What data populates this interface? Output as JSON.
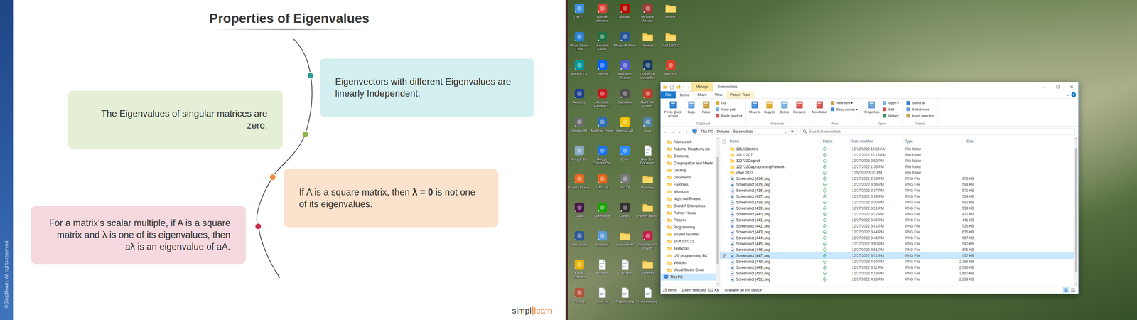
{
  "slide": {
    "watermark": "©Simplilearn. All rights reserved.",
    "title": "Properties of Eigenvalues",
    "properties": [
      {
        "segments": [
          {
            "text": "Eigenvectors with different Eigenvalues are linearly Independent.",
            "bold": false
          }
        ],
        "color": "#d3eff0",
        "dot_color": "#2f9c94"
      },
      {
        "segments": [
          {
            "text": "The Eigenvalues of singular matrices are zero.",
            "bold": false
          }
        ],
        "color": "#e4efd6",
        "dot_color": "#8fb448"
      },
      {
        "segments": [
          {
            "text": "If A is a square matrix, then ",
            "bold": false
          },
          {
            "text": "λ = 0",
            "bold": true
          },
          {
            "text": " is not one of its eigenvalues.",
            "bold": false
          }
        ],
        "color": "#fbe2cd",
        "dot_color": "#f08c3a"
      },
      {
        "segments": [
          {
            "text": "For a matrix's scalar multiple, if A is a square matrix and λ is one of its eigenvalues, then aλ is an eigenvalue of aA.",
            "bold": false
          }
        ],
        "color": "#f5d9df",
        "dot_color": "#c9304c"
      }
    ],
    "logo": {
      "left": "simpl",
      "right": "learn"
    }
  },
  "desktop": {
    "icons": [
      {
        "label": "This PC",
        "kind": "app",
        "color": "#3d8fe0"
      },
      {
        "label": "Visual Studio Code",
        "kind": "app",
        "color": "#2a7fd4"
      },
      {
        "label": "Arduino IDE",
        "kind": "app",
        "color": "#00979d"
      },
      {
        "label": "Audacity",
        "kind": "app",
        "color": "#1d3f8c"
      },
      {
        "label": "Simplify3D",
        "kind": "app",
        "color": "#6b6b6b"
      },
      {
        "label": "Recycle Bin",
        "kind": "app",
        "color": "#8aa6c1"
      },
      {
        "label": "Mozilla Firefox",
        "kind": "app",
        "color": "#e66a21"
      },
      {
        "label": "Slack",
        "kind": "app",
        "color": "#4a154b"
      },
      {
        "label": "Video Editor",
        "kind": "app",
        "color": "#2b5797"
      },
      {
        "label": "Kodak Software",
        "kind": "app",
        "color": "#e9b308"
      },
      {
        "label": "Fritzing",
        "kind": "app",
        "color": "#b5523b"
      },
      {
        "label": "Google Chrome",
        "kind": "app",
        "color": "#db4437"
      },
      {
        "label": "Microsoft Excel",
        "kind": "app",
        "color": "#1e7145"
      },
      {
        "label": "Dropbox",
        "kind": "app",
        "color": "#0061fe"
      },
      {
        "label": "Acrobat Reader DC",
        "kind": "app",
        "color": "#c4161c"
      },
      {
        "label": "Mathcad Prime",
        "kind": "app",
        "color": "#2c6fb5"
      },
      {
        "label": "Google Chrome Dev",
        "kind": "app",
        "color": "#1a73e8"
      },
      {
        "label": "MATLAB",
        "kind": "app",
        "color": "#e1641b"
      },
      {
        "label": "LibreOffice",
        "kind": "app",
        "color": "#18a303"
      },
      {
        "label": "Notepad",
        "kind": "app",
        "color": "#5b9bd5"
      },
      {
        "label": "budget.txt",
        "kind": "file",
        "color": "#ffffff"
      },
      {
        "label": "notes.txt",
        "kind": "file",
        "color": "#ffffff"
      },
      {
        "label": "Acrobat",
        "kind": "app",
        "color": "#b30b00"
      },
      {
        "label": "Microsoft Word",
        "kind": "app",
        "color": "#2b579a"
      },
      {
        "label": "Microsoft Teams",
        "kind": "app",
        "color": "#5059c9"
      },
      {
        "label": "Calculator",
        "kind": "app",
        "color": "#505050"
      },
      {
        "label": "OpenSCAD",
        "kind": "app",
        "color": "#f2c200"
      },
      {
        "label": "Zoom",
        "kind": "app",
        "color": "#2d8cff"
      },
      {
        "label": "PuTTY",
        "kind": "app",
        "color": "#7a7a7a"
      },
      {
        "label": "Camera",
        "kind": "app",
        "color": "#333333"
      },
      {
        "label": "screenshots",
        "kind": "folder",
        "color": "#f3c74f"
      },
      {
        "label": "Chip.png",
        "kind": "file",
        "color": "#ffffff"
      },
      {
        "label": "Registry.png",
        "kind": "file",
        "color": "#ffffff"
      },
      {
        "label": "Microsoft Access",
        "kind": "app",
        "color": "#a4373a"
      },
      {
        "label": "Projects",
        "kind": "folder",
        "color": "#f3c74f"
      },
      {
        "label": "Oracle VM VirtualBox",
        "kind": "app",
        "color": "#183a61"
      },
      {
        "label": "Night Owl Protect",
        "kind": "app",
        "color": "#c0392b"
      },
      {
        "label": "Java",
        "kind": "app",
        "color": "#5382a1"
      },
      {
        "label": "New Text Document",
        "kind": "file",
        "color": "#ffffff"
      },
      {
        "label": "Drawings",
        "kind": "folder",
        "color": "#f3c74f"
      },
      {
        "label": "Palmer House",
        "kind": "folder",
        "color": "#f3c74f"
      },
      {
        "label": "Raspberry Pi Imager",
        "kind": "app",
        "color": "#c51a4a"
      },
      {
        "label": "Receipts",
        "kind": "folder",
        "color": "#f3c74f"
      },
      {
        "label": "Hardware.jpg",
        "kind": "file",
        "color": "#ffffff"
      },
      {
        "label": "Photos",
        "kind": "folder",
        "color": "#f3c74f"
      },
      {
        "label": "Stuff 100122",
        "kind": "folder",
        "color": "#f3c74f"
      },
      {
        "label": "Nitro Pro",
        "kind": "app",
        "color": "#d93f2b"
      }
    ]
  },
  "explorer": {
    "title": "Screenshots",
    "context_tab": "Manage",
    "controls": [
      "—",
      "☐",
      "✕"
    ],
    "ribbon_tabs": [
      {
        "label": "File",
        "kind": "file",
        "selected": false
      },
      {
        "label": "Home",
        "kind": "tab",
        "selected": true
      },
      {
        "label": "Share",
        "kind": "tab",
        "selected": false
      },
      {
        "label": "View",
        "kind": "tab",
        "selected": false
      },
      {
        "label": "Picture Tools",
        "kind": "context",
        "selected": false
      }
    ],
    "ribbon_help": [
      "⌄",
      "?"
    ],
    "groups": [
      {
        "label": "Clipboard",
        "buttons": [
          {
            "label": "Pin to Quick access",
            "kind": "large"
          },
          {
            "label": "Copy",
            "kind": "large"
          },
          {
            "label": "Paste",
            "kind": "large"
          },
          {
            "label": "Cut",
            "kind": "small"
          },
          {
            "label": "Copy path",
            "kind": "small"
          },
          {
            "label": "Paste shortcut",
            "kind": "small"
          }
        ]
      },
      {
        "label": "Organize",
        "buttons": [
          {
            "label": "Move to",
            "kind": "large"
          },
          {
            "label": "Copy to",
            "kind": "large"
          },
          {
            "label": "Delete",
            "kind": "large"
          },
          {
            "label": "Rename",
            "kind": "large"
          }
        ]
      },
      {
        "label": "New",
        "buttons": [
          {
            "label": "New folder",
            "kind": "large"
          },
          {
            "label": "New item ▾",
            "kind": "small"
          },
          {
            "label": "Easy access ▾",
            "kind": "small"
          }
        ]
      },
      {
        "label": "Open",
        "buttons": [
          {
            "label": "Properties",
            "kind": "large"
          },
          {
            "label": "Open ▾",
            "kind": "small"
          },
          {
            "label": "Edit",
            "kind": "small"
          },
          {
            "label": "History",
            "kind": "small"
          }
        ]
      },
      {
        "label": "Select",
        "buttons": [
          {
            "label": "Select all",
            "kind": "small"
          },
          {
            "label": "Select none",
            "kind": "small"
          },
          {
            "label": "Invert selection",
            "kind": "small"
          }
        ]
      }
    ],
    "address": {
      "nav": [
        "←",
        "→",
        "⌄",
        "↑"
      ],
      "path": [
        "This PC",
        "Pictures",
        "Screenshots"
      ],
      "separator": "›",
      "dropdown": "⌄",
      "refresh": "⟳"
    },
    "search": {
      "placeholder": "Search Screenshots"
    },
    "nav": [
      {
        "label": "Allens work",
        "kind": "folder",
        "selected": false
      },
      {
        "label": "Arduino_Raspberry pie",
        "kind": "folder",
        "selected": false
      },
      {
        "label": "Coursera",
        "kind": "folder",
        "selected": false
      },
      {
        "label": "Congregation and Meetin",
        "kind": "folder",
        "selected": false
      },
      {
        "label": "Desktop",
        "kind": "folder",
        "selected": false
      },
      {
        "label": "Documents",
        "kind": "folder",
        "selected": false
      },
      {
        "label": "Favorites",
        "kind": "folder",
        "selected": false
      },
      {
        "label": "Microcom",
        "kind": "folder",
        "selected": false
      },
      {
        "label": "Night owl Protect",
        "kind": "folder",
        "selected": false
      },
      {
        "label": "O and A Enterprises",
        "kind": "folder",
        "selected": false
      },
      {
        "label": "Palmer House",
        "kind": "folder",
        "selected": false
      },
      {
        "label": "Pictures",
        "kind": "folder",
        "selected": false
      },
      {
        "label": "Programming",
        "kind": "folder",
        "selected": false
      },
      {
        "label": "Shared favorites",
        "kind": "folder",
        "selected": false
      },
      {
        "label": "Stuff 100122",
        "kind": "folder",
        "selected": false
      },
      {
        "label": "Textbooks",
        "kind": "folder",
        "selected": false
      },
      {
        "label": "UW programming BC",
        "kind": "folder",
        "selected": false
      },
      {
        "label": "Vehicles",
        "kind": "folder",
        "selected": false
      },
      {
        "label": "Visual Studio Code",
        "kind": "folder",
        "selected": false
      },
      {
        "label": "This PC",
        "kind": "pc",
        "selected": true
      }
    ],
    "columns": [
      "Name",
      "Status",
      "Date modified",
      "Type",
      "Size"
    ],
    "select_all_checked": false,
    "rows": [
      {
        "name": "121222before",
        "date": "12/12/2022 10:26 AM",
        "type": "File folder",
        "size": "",
        "kind": "folder",
        "selected": false,
        "synced": true
      },
      {
        "name": "121222CT",
        "date": "12/27/2022 12:16 PM",
        "type": "File folder",
        "size": "",
        "kind": "folder",
        "selected": false,
        "synced": true
      },
      {
        "name": "122722Calprob",
        "date": "12/27/2022 2:52 PM",
        "type": "File folder",
        "size": "",
        "kind": "folder",
        "selected": false,
        "synced": true
      },
      {
        "name": "122722CalprogramingPrework",
        "date": "12/27/2022 1:36 PM",
        "type": "File folder",
        "size": "",
        "kind": "folder",
        "selected": false,
        "synced": true
      },
      {
        "name": "other 2022",
        "date": "12/5/2022 5:30 PM",
        "type": "File folder",
        "size": "",
        "kind": "folder",
        "selected": false,
        "synced": true
      },
      {
        "name": "Screenshot (434).png",
        "date": "12/27/2022 2:53 PM",
        "type": "PNG File",
        "size": "976 KB",
        "kind": "png",
        "selected": false,
        "synced": true
      },
      {
        "name": "Screenshot (435).png",
        "date": "12/27/2022 3:16 PM",
        "type": "PNG File",
        "size": "594 KB",
        "kind": "png",
        "selected": false,
        "synced": true
      },
      {
        "name": "Screenshot (436).png",
        "date": "12/27/2022 3:17 PM",
        "type": "PNG File",
        "size": "571 KB",
        "kind": "png",
        "selected": false,
        "synced": true
      },
      {
        "name": "Screenshot (437).png",
        "date": "12/27/2022 3:19 PM",
        "type": "PNG File",
        "size": "524 KB",
        "kind": "png",
        "selected": false,
        "synced": true
      },
      {
        "name": "Screenshot (438).png",
        "date": "12/27/2022 3:30 PM",
        "type": "PNG File",
        "size": "992 KB",
        "kind": "png",
        "selected": false,
        "synced": true
      },
      {
        "name": "Screenshot (439).png",
        "date": "12/27/2022 3:31 PM",
        "type": "PNG File",
        "size": "539 KB",
        "kind": "png",
        "selected": false,
        "synced": true
      },
      {
        "name": "Screenshot (440).png",
        "date": "12/27/2022 3:32 PM",
        "type": "PNG File",
        "size": "421 KB",
        "kind": "png",
        "selected": false,
        "synced": true
      },
      {
        "name": "Screenshot (441).png",
        "date": "12/27/2022 3:40 PM",
        "type": "PNG File",
        "size": "441 KB",
        "kind": "png",
        "selected": false,
        "synced": true
      },
      {
        "name": "Screenshot (442).png",
        "date": "12/27/2022 3:41 PM",
        "type": "PNG File",
        "size": "536 KB",
        "kind": "png",
        "selected": false,
        "synced": true
      },
      {
        "name": "Screenshot (443).png",
        "date": "12/27/2022 3:44 PM",
        "type": "PNG File",
        "size": "635 KB",
        "kind": "png",
        "selected": false,
        "synced": true
      },
      {
        "name": "Screenshot (444).png",
        "date": "12/27/2022 3:46 PM",
        "type": "PNG File",
        "size": "667 KB",
        "kind": "png",
        "selected": false,
        "synced": true
      },
      {
        "name": "Screenshot (445).png",
        "date": "12/27/2022 3:50 PM",
        "type": "PNG File",
        "size": "540 KB",
        "kind": "png",
        "selected": false,
        "synced": true
      },
      {
        "name": "Screenshot (446).png",
        "date": "12/27/2022 3:51 PM",
        "type": "PNG File",
        "size": "605 KB",
        "kind": "png",
        "selected": false,
        "synced": true
      },
      {
        "name": "Screenshot (447).png",
        "date": "12/27/2022 3:51 PM",
        "type": "PNG File",
        "size": "532 KB",
        "kind": "png",
        "selected": true,
        "synced": true
      },
      {
        "name": "Screenshot (448).png",
        "date": "12/27/2022 4:10 PM",
        "type": "PNG File",
        "size": "2,386 KB",
        "kind": "png",
        "selected": false,
        "synced": true
      },
      {
        "name": "Screenshot (449).png",
        "date": "12/27/2022 4:11 PM",
        "type": "PNG File",
        "size": "2,098 KB",
        "kind": "png",
        "selected": false,
        "synced": true
      },
      {
        "name": "Screenshot (450).png",
        "date": "12/27/2022 4:13 PM",
        "type": "PNG File",
        "size": "2,650 KB",
        "kind": "png",
        "selected": false,
        "synced": true
      },
      {
        "name": "Screenshot (451).png",
        "date": "12/27/2022 4:18 PM",
        "type": "PNG File",
        "size": "2,239 KB",
        "kind": "png",
        "selected": false,
        "synced": true
      }
    ],
    "status_bar": {
      "items": "25 items",
      "selection": "1 item selected  532 KB",
      "availability": "Available on this device"
    },
    "views": [
      {
        "kind": "details",
        "selected": true
      },
      {
        "kind": "tiles",
        "selected": false
      }
    ]
  }
}
